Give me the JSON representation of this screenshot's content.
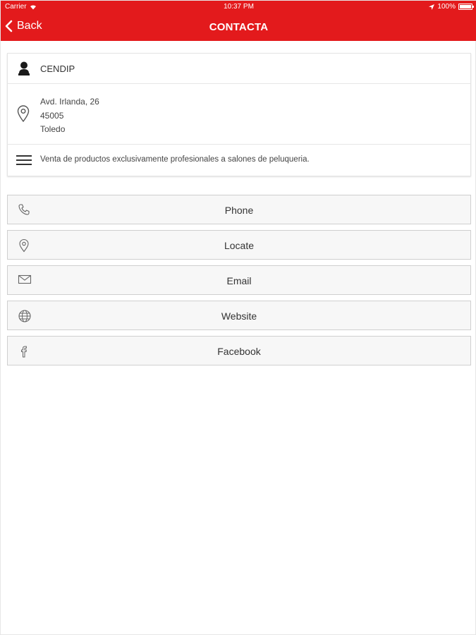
{
  "status_bar": {
    "carrier": "Carrier",
    "time": "10:37 PM",
    "battery": "100%"
  },
  "nav": {
    "back_label": "Back",
    "title": "CONTACTA"
  },
  "colors": {
    "header_bg": "#e31a1c",
    "header_text": "#ffffff",
    "button_bg": "#f7f7f7"
  },
  "info": {
    "name": "CENDIP",
    "address": {
      "street": "Avd. Irlanda, 26",
      "postal_code": "45005",
      "city": "Toledo"
    },
    "description": "Venta de productos exclusivamente profesionales a salones de peluqueria."
  },
  "actions": [
    {
      "label": "Phone",
      "icon": "phone-icon"
    },
    {
      "label": "Locate",
      "icon": "location-pin-icon"
    },
    {
      "label": "Email",
      "icon": "envelope-icon"
    },
    {
      "label": "Website",
      "icon": "globe-icon"
    },
    {
      "label": "Facebook",
      "icon": "facebook-icon"
    }
  ]
}
